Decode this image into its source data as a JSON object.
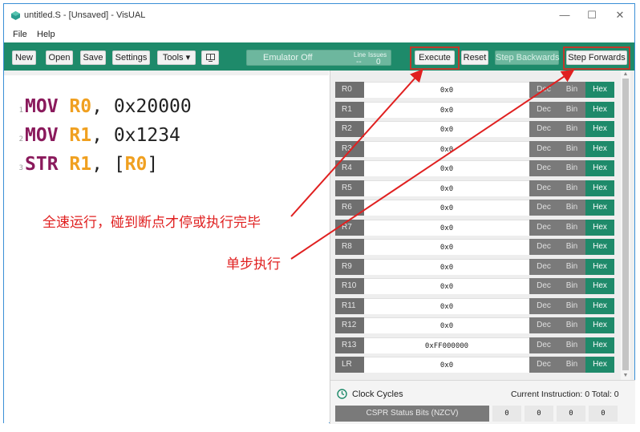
{
  "window": {
    "title": "untitled.S - [Unsaved] - VisUAL",
    "controls": {
      "minimize": "—",
      "maximize": "☐",
      "close": "✕"
    }
  },
  "menu": {
    "file": "File",
    "help": "Help"
  },
  "toolbar": {
    "new": "New",
    "open": "Open",
    "save": "Save",
    "settings": "Settings",
    "tools": "Tools ▾",
    "emulator_status": "Emulator Off",
    "line_label": "Line",
    "line_value": "--",
    "issues_label": "Issues",
    "issues_value": "0",
    "execute": "Execute",
    "reset": "Reset",
    "step_backwards": "Step Backwards",
    "step_forwards": "Step Forwards"
  },
  "editor": {
    "lines": [
      {
        "num": "1",
        "op": "MOV",
        "r1": "R0",
        "sep": ", ",
        "rest": "0x20000"
      },
      {
        "num": "2",
        "op": "MOV",
        "r1": "R1",
        "sep": ", ",
        "rest": "0x1234"
      },
      {
        "num": "3",
        "op": "STR",
        "r1": "R1",
        "sep": ", ",
        "open": "[",
        "r2": "R0",
        "close": "]"
      }
    ]
  },
  "annotations": {
    "execute_note": "全速运行，碰到断点才停或执行完毕",
    "step_note": "单步执行"
  },
  "registers": [
    {
      "name": "R0",
      "value": "0x0"
    },
    {
      "name": "R1",
      "value": "0x0"
    },
    {
      "name": "R2",
      "value": "0x0"
    },
    {
      "name": "R3",
      "value": "0x0"
    },
    {
      "name": "R4",
      "value": "0x0"
    },
    {
      "name": "R5",
      "value": "0x0"
    },
    {
      "name": "R6",
      "value": "0x0"
    },
    {
      "name": "R7",
      "value": "0x0"
    },
    {
      "name": "R8",
      "value": "0x0"
    },
    {
      "name": "R9",
      "value": "0x0"
    },
    {
      "name": "R10",
      "value": "0x0"
    },
    {
      "name": "R11",
      "value": "0x0"
    },
    {
      "name": "R12",
      "value": "0x0"
    },
    {
      "name": "R13",
      "value": "0xFF000000"
    },
    {
      "name": "LR",
      "value": "0x0"
    }
  ],
  "format_buttons": {
    "dec": "Dec",
    "bin": "Bin",
    "hex": "Hex"
  },
  "status": {
    "clock_cycles": "Clock Cycles",
    "current_instruction": "Current Instruction: 0  Total: 0",
    "cpsr_label": "CSPR Status Bits (NZCV)",
    "flags": [
      "0",
      "0",
      "0",
      "0"
    ]
  },
  "colors": {
    "toolbar": "#1e8a6a",
    "highlight": "#c0392b",
    "annotation": "#e02020",
    "keyword": "#8a1a5c",
    "register": "#f0a020"
  }
}
